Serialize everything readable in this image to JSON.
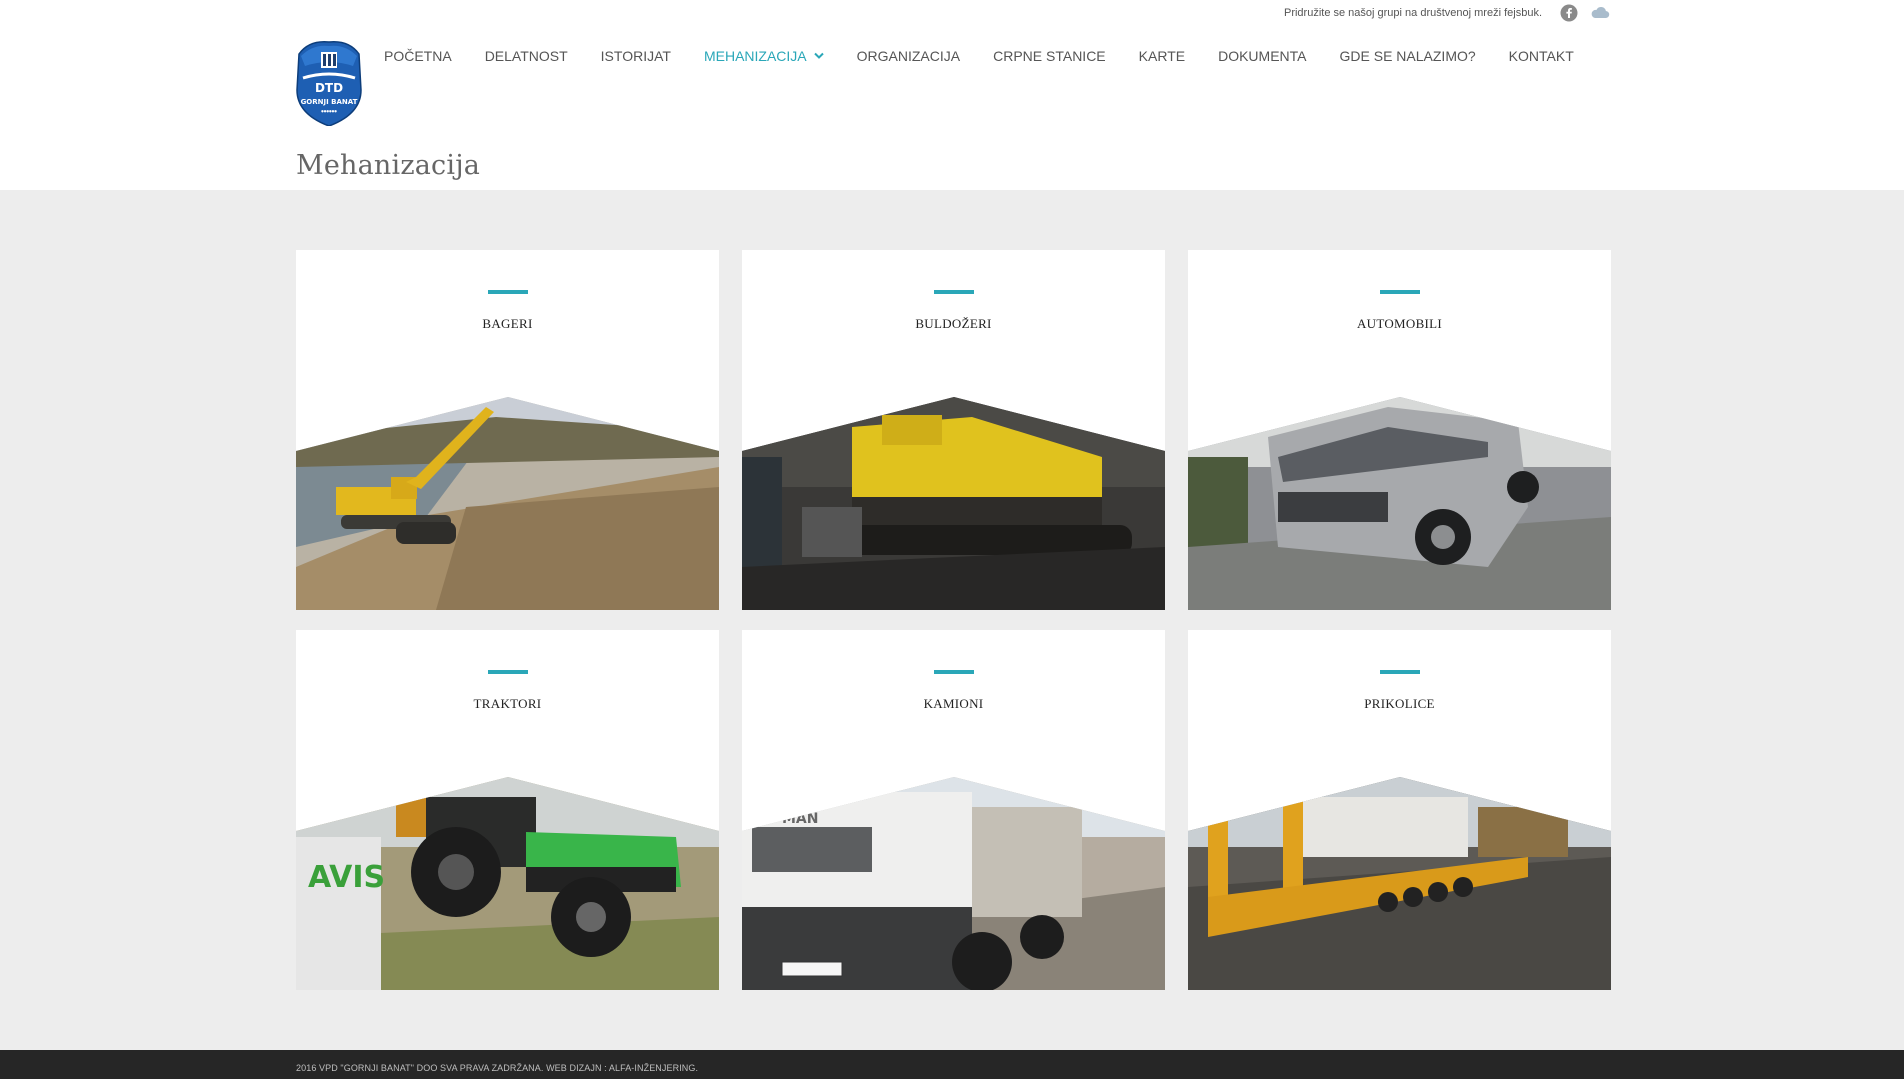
{
  "topbar": {
    "text": "Pridružite se našoj grupi na društvenoj mreži fejsbuk.",
    "icons": [
      "facebook-icon",
      "cloud-icon"
    ]
  },
  "logo": {
    "text": "GORNJI BANAT"
  },
  "nav": {
    "items": [
      {
        "label": "POČETNA"
      },
      {
        "label": "DELATNOST"
      },
      {
        "label": "ISTORIJAT"
      },
      {
        "label": "MEHANIZACIJA",
        "active": true,
        "has_dropdown": true
      },
      {
        "label": "ORGANIZACIJA"
      },
      {
        "label": "CRPNE STANICE"
      },
      {
        "label": "KARTE"
      },
      {
        "label": "DOKUMENTA"
      },
      {
        "label": "GDE SE NALAZIMO?"
      },
      {
        "label": "KONTAKT"
      }
    ]
  },
  "page": {
    "title": "Mehanizacija"
  },
  "cards": [
    {
      "title": "BAGERI",
      "image": "excavator"
    },
    {
      "title": "BULDOŽERI",
      "image": "bulldozer"
    },
    {
      "title": "AUTOMOBILI",
      "image": "pickup-car"
    },
    {
      "title": "TRAKTORI",
      "image": "tractor"
    },
    {
      "title": "KAMIONI",
      "image": "truck"
    },
    {
      "title": "PRIKOLICE",
      "image": "trailer"
    }
  ],
  "footer": {
    "text": "2016 VPD \"GORNJI BANAT\" DOO SVA PRAVA ZADRŽANA. WEB DIZAJN : ALFA-INŽENJERING."
  },
  "colors": {
    "accent": "#2aa7b8",
    "footer_bg": "#262626",
    "page_bg": "#ededed"
  }
}
